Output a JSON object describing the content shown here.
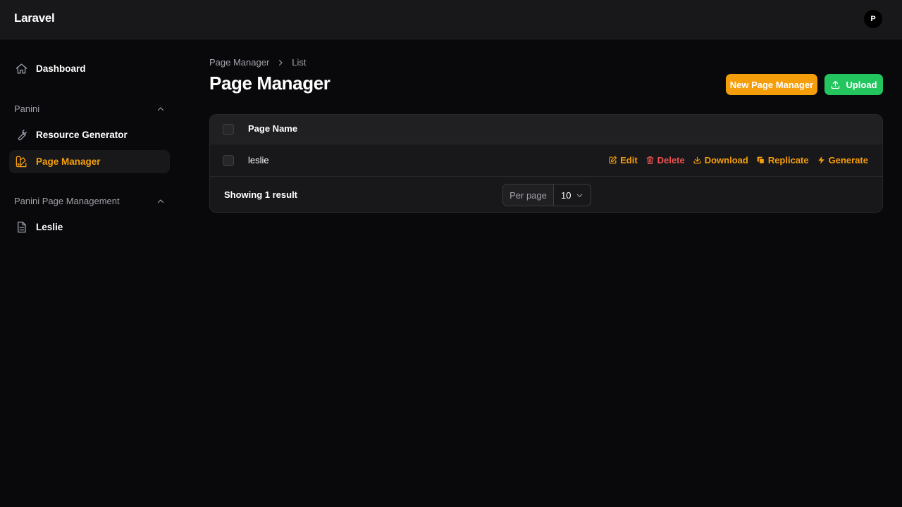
{
  "app": {
    "brand": "Laravel",
    "avatar_initial": "P"
  },
  "sidebar": {
    "dashboard": "Dashboard",
    "group1": {
      "label": "Panini",
      "items": [
        {
          "label": "Resource Generator"
        },
        {
          "label": "Page Manager",
          "active": true
        }
      ]
    },
    "group2": {
      "label": "Panini Page Management",
      "items": [
        {
          "label": "Leslie"
        }
      ]
    }
  },
  "breadcrumb": {
    "parent": "Page Manager",
    "current": "List"
  },
  "page": {
    "title": "Page Manager"
  },
  "header_actions": {
    "new_label": "New Page Manager",
    "upload_label": "Upload"
  },
  "table": {
    "columns": [
      "Page Name"
    ],
    "rows": [
      {
        "name": "leslie",
        "actions": {
          "edit": "Edit",
          "delete": "Delete",
          "download": "Download",
          "replicate": "Replicate",
          "generate": "Generate"
        }
      }
    ],
    "footer": {
      "showing": "Showing 1 result",
      "per_page_label": "Per page",
      "per_page_value": "10"
    }
  },
  "colors": {
    "accent": "#f59e0b",
    "success": "#22c55e",
    "danger": "#f05252",
    "background": "#09090b",
    "surface": "#18181b"
  },
  "icons": [
    "home-icon",
    "wrench-icon",
    "swatch-icon",
    "document-icon",
    "chevron-up-icon",
    "chevron-right-icon",
    "upload-icon",
    "edit-icon",
    "trash-icon",
    "download-icon",
    "copy-icon",
    "bolt-icon",
    "chevron-down-icon"
  ]
}
